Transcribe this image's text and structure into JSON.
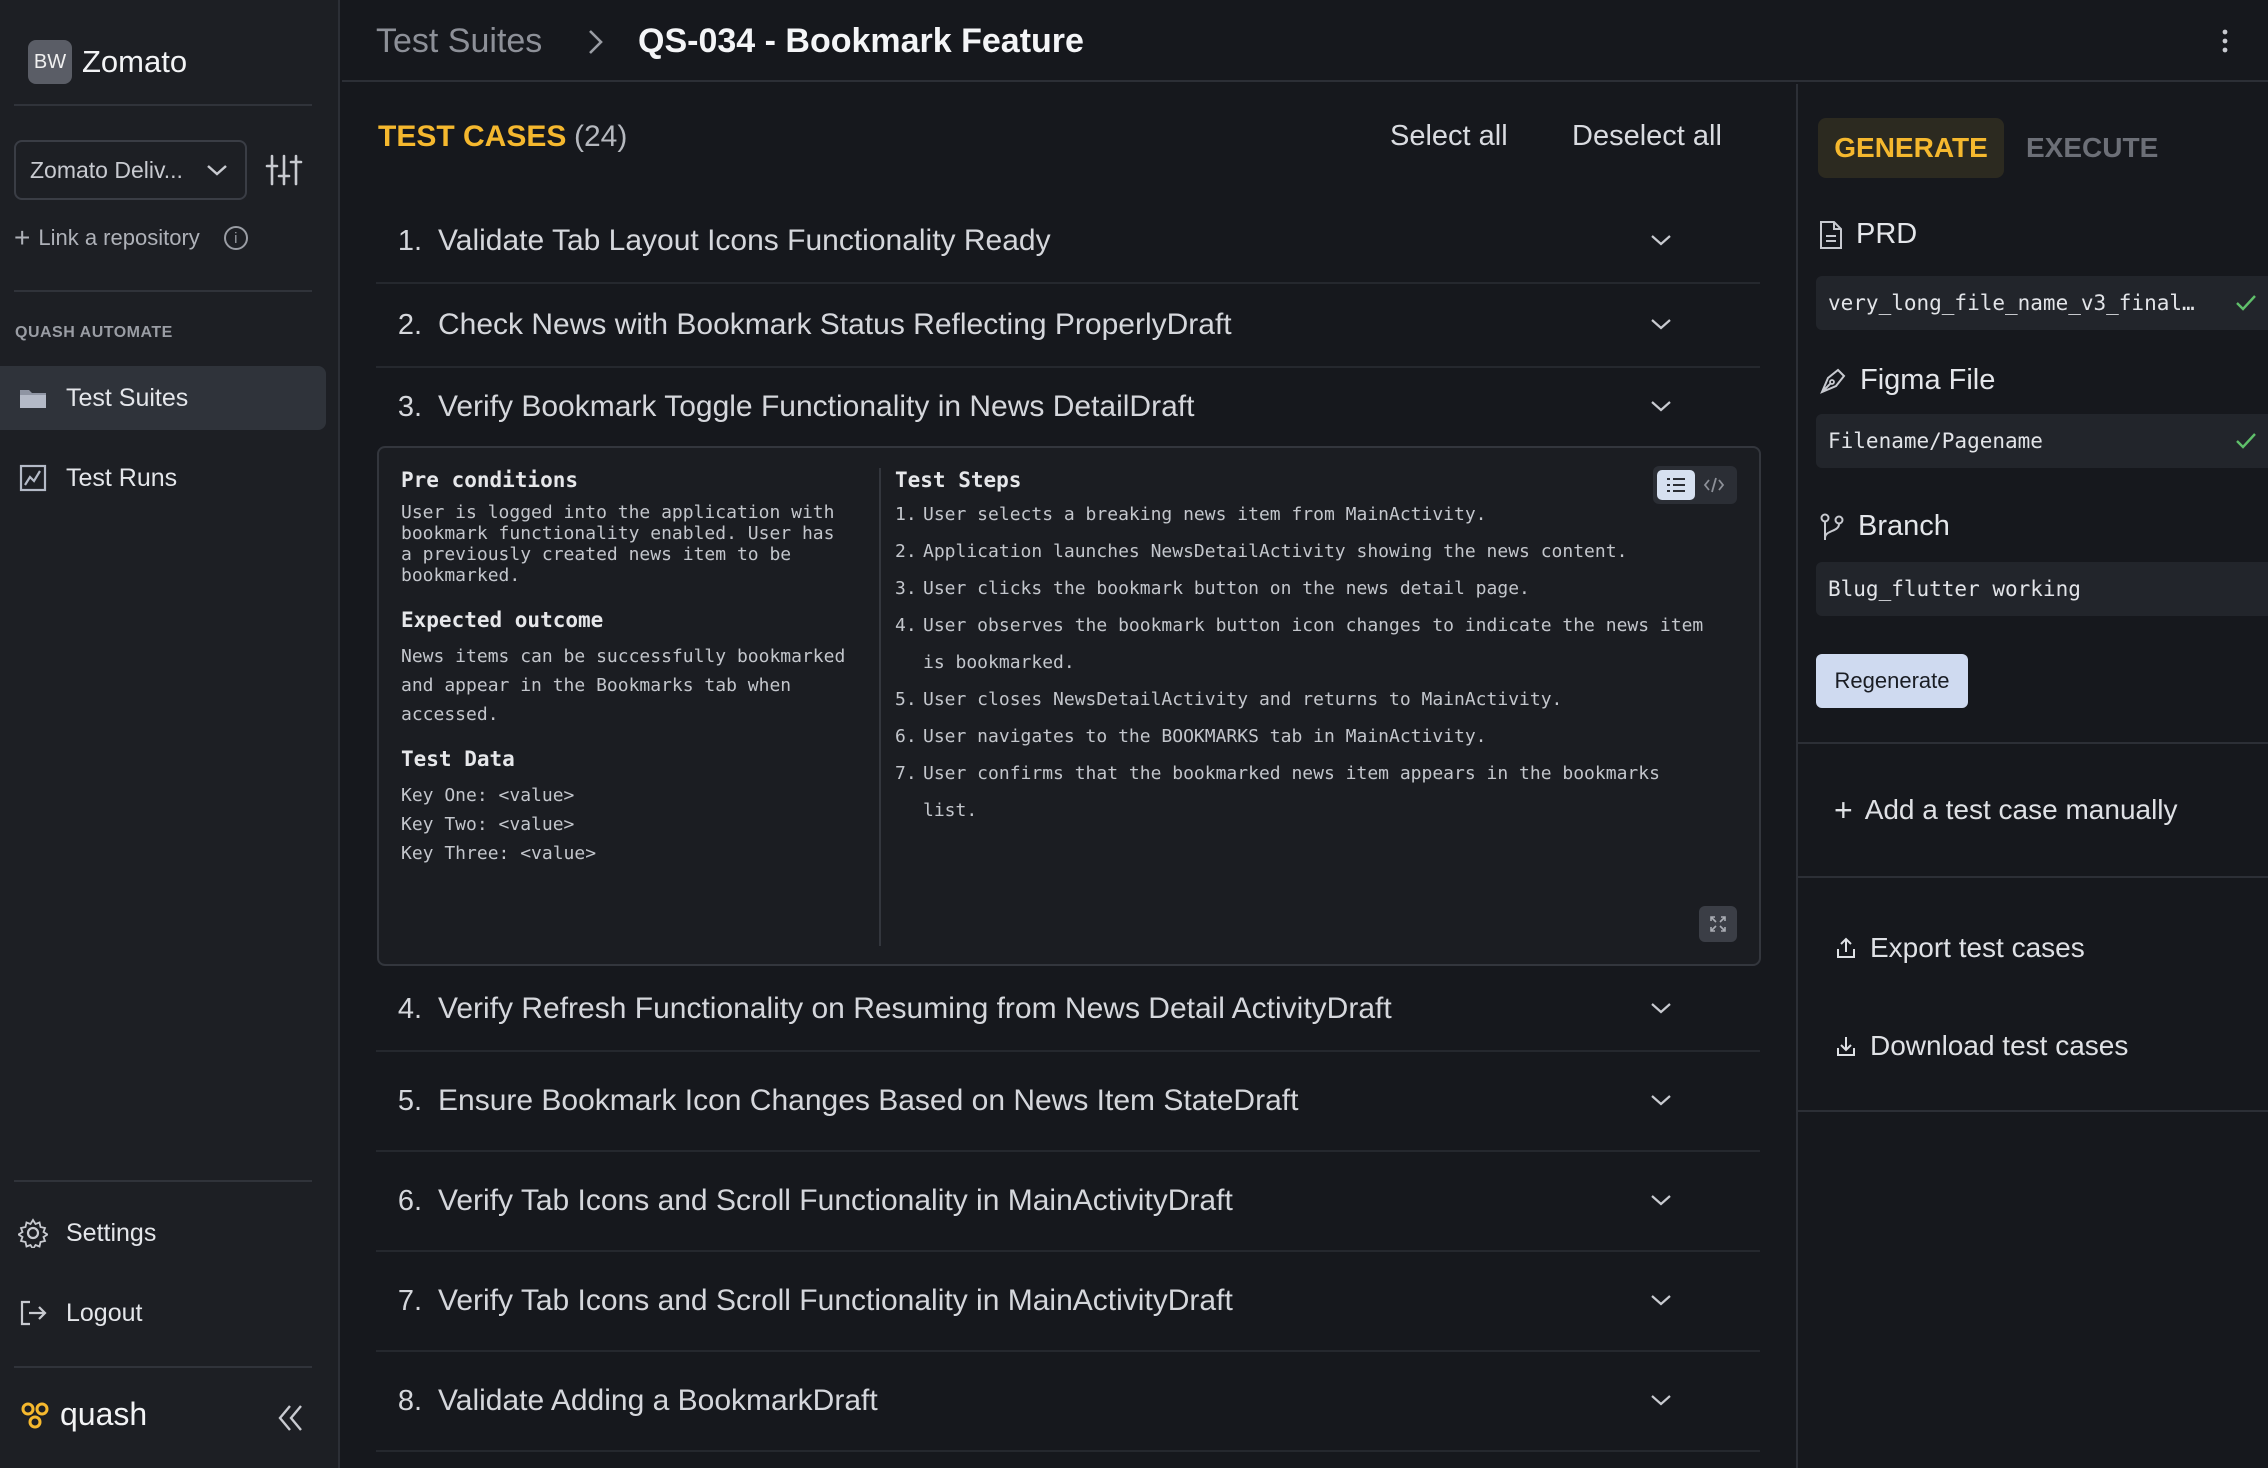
{
  "sidebar": {
    "brand_badge": "BW",
    "brand_name": "Zomato",
    "project_select": "Zomato Deliv...",
    "link_repo": "Link a repository",
    "section_label": "QUASH AUTOMATE",
    "nav": [
      {
        "label": "Test Suites",
        "icon": "folder-icon"
      },
      {
        "label": "Test Runs",
        "icon": "chart-icon"
      }
    ],
    "settings": "Settings",
    "logout": "Logout",
    "logo_text": "quash"
  },
  "header": {
    "crumb_parent": "Test Suites",
    "crumb_current": "QS-034 - Bookmark Feature"
  },
  "main": {
    "title": "TEST CASES",
    "count": "(24)",
    "select_all": "Select all",
    "deselect_all": "Deselect all",
    "test_cases": [
      {
        "num": "1.",
        "title": "Validate Tab Layout Icons Functionality Ready"
      },
      {
        "num": "2.",
        "title": "Check News with Bookmark Status Reflecting ProperlyDraft"
      },
      {
        "num": "3.",
        "title": "Verify Bookmark Toggle Functionality in News DetailDraft"
      },
      {
        "num": "4.",
        "title": "Verify Refresh Functionality on Resuming from News Detail ActivityDraft"
      },
      {
        "num": "5.",
        "title": "Ensure Bookmark Icon Changes Based on News Item StateDraft"
      },
      {
        "num": "6.",
        "title": "Verify Tab Icons and Scroll Functionality in MainActivityDraft"
      },
      {
        "num": "7.",
        "title": "Verify Tab Icons and Scroll Functionality in MainActivityDraft"
      },
      {
        "num": "8.",
        "title": "Validate Adding a BookmarkDraft"
      }
    ],
    "detail": {
      "pre_conditions_label": "Pre conditions",
      "pre_conditions": "User is logged into the application with\nbookmark functionality enabled. User has\na previously created news item to be\nbookmarked.",
      "expected_label": "Expected outcome",
      "expected": "News items can be successfully bookmarked\nand appear in the Bookmarks tab when\naccessed.",
      "test_data_label": "Test Data",
      "test_data": "Key One: <value>\nKey Two: <value>\nKey Three: <value>",
      "steps_label": "Test Steps",
      "steps": [
        {
          "n": "1.",
          "text": "User selects a breaking news item from MainActivity."
        },
        {
          "n": "2.",
          "text": "Application launches NewsDetailActivity showing the news content."
        },
        {
          "n": "3.",
          "text": "User clicks the bookmark button on the news detail page."
        },
        {
          "n": "4.",
          "text": "User observes the bookmark button icon changes to indicate the news item is bookmarked."
        },
        {
          "n": "5.",
          "text": "User closes NewsDetailActivity and returns to MainActivity."
        },
        {
          "n": "6.",
          "text": "User navigates to the BOOKMARKS tab in MainActivity."
        },
        {
          "n": "7.",
          "text": "User confirms that the bookmarked news item appears in the bookmarks list."
        }
      ]
    }
  },
  "right_panel": {
    "tab_generate": "GENERATE",
    "tab_execute": "EXECUTE",
    "prd_label": "PRD",
    "prd_value": "very_long_file_name_v3_final…",
    "figma_label": "Figma File",
    "figma_value": "Filename/Pagename",
    "branch_label": "Branch",
    "branch_value": "Blug_flutter working",
    "regenerate": "Regenerate",
    "add_manual": "Add a test case manually",
    "export": "Export test cases",
    "download": "Download test cases"
  },
  "colors": {
    "accent": "#f5b82e",
    "check": "#5fbf6a",
    "background": "#16181d",
    "sidebar": "#1d1f24"
  }
}
